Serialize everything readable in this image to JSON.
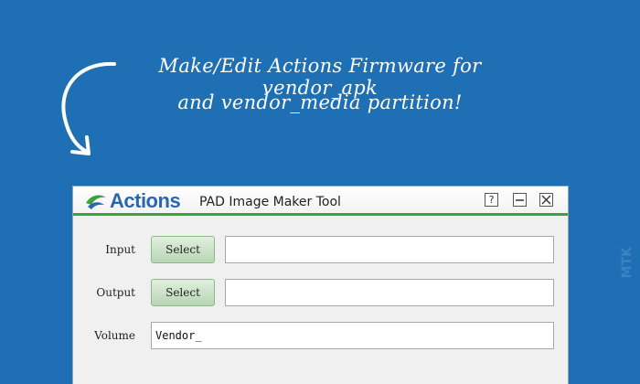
{
  "banner": {
    "line1": "Make/Edit Actions Firmware for vendor_apk",
    "line2": "and vendor_media partition!"
  },
  "watermark": "MTK",
  "window": {
    "logo_text": "Actions",
    "title": "PAD Image Maker Tool",
    "help_label": "?",
    "accent_color": "#3ea23a"
  },
  "form": {
    "input_label": "Input",
    "input_button": "Select",
    "input_value": "",
    "output_label": "Output",
    "output_button": "Select",
    "output_value": "",
    "volume_label": "Volume",
    "volume_value": "Vendor_"
  }
}
